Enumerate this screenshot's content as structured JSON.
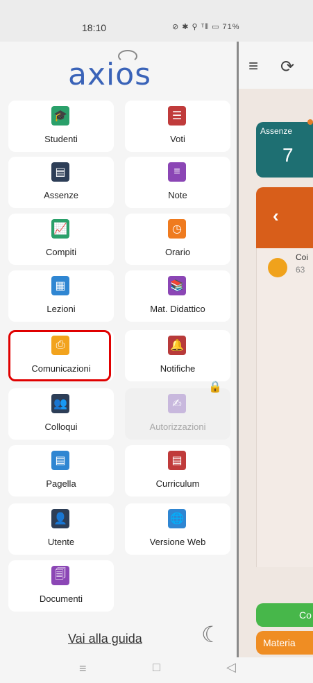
{
  "status_bar": {
    "time": "18:10",
    "icons_text": "⊘ ✱ ⚲ ᵀ⫴ ▭ 71%"
  },
  "app": {
    "logo_text": "axios"
  },
  "menu": {
    "tiles": [
      {
        "label": "Studenti",
        "icon": "graduation-cap-icon",
        "color": "#2aa06a"
      },
      {
        "label": "Voti",
        "icon": "clipboard-icon",
        "color": "#c03b3b"
      },
      {
        "label": "Assenze",
        "icon": "bed-icon",
        "color": "#2d3e57"
      },
      {
        "label": "Note",
        "icon": "note-icon",
        "color": "#8b46b5"
      },
      {
        "label": "Compiti",
        "icon": "chart-icon",
        "color": "#2aa06a"
      },
      {
        "label": "Orario",
        "icon": "clock-icon",
        "color": "#ef7b1f"
      },
      {
        "label": "Lezioni",
        "icon": "lesson-icon",
        "color": "#2f86d2"
      },
      {
        "label": "Mat. Didattico",
        "icon": "books-icon",
        "color": "#8b46b5"
      },
      {
        "label": "Comunicazioni",
        "icon": "pdf-icon",
        "color": "#f2a31d"
      },
      {
        "label": "Notifiche",
        "icon": "bell-icon",
        "color": "#b83a3a"
      },
      {
        "label": "Colloqui",
        "icon": "people-icon",
        "color": "#2d3e57"
      },
      {
        "label": "Autorizzazioni",
        "icon": "signature-icon",
        "color": "#c8b8dd"
      },
      {
        "label": "Pagella",
        "icon": "report-icon",
        "color": "#2f86d2"
      },
      {
        "label": "Curriculum",
        "icon": "document-icon",
        "color": "#c03b3b"
      },
      {
        "label": "Utente",
        "icon": "user-icon",
        "color": "#2d3e57"
      },
      {
        "label": "Versione Web",
        "icon": "globe-icon",
        "color": "#2f86d2"
      },
      {
        "label": "Documenti",
        "icon": "files-icon",
        "color": "#8b46b5"
      }
    ],
    "guide_link": "Vai alla guida"
  },
  "right_panel": {
    "assenze_title": "Assenze",
    "assenze_count": "7",
    "item_line1": "Coi",
    "item_line2": "63",
    "green_button": "Co",
    "orange_button": "Materia"
  }
}
